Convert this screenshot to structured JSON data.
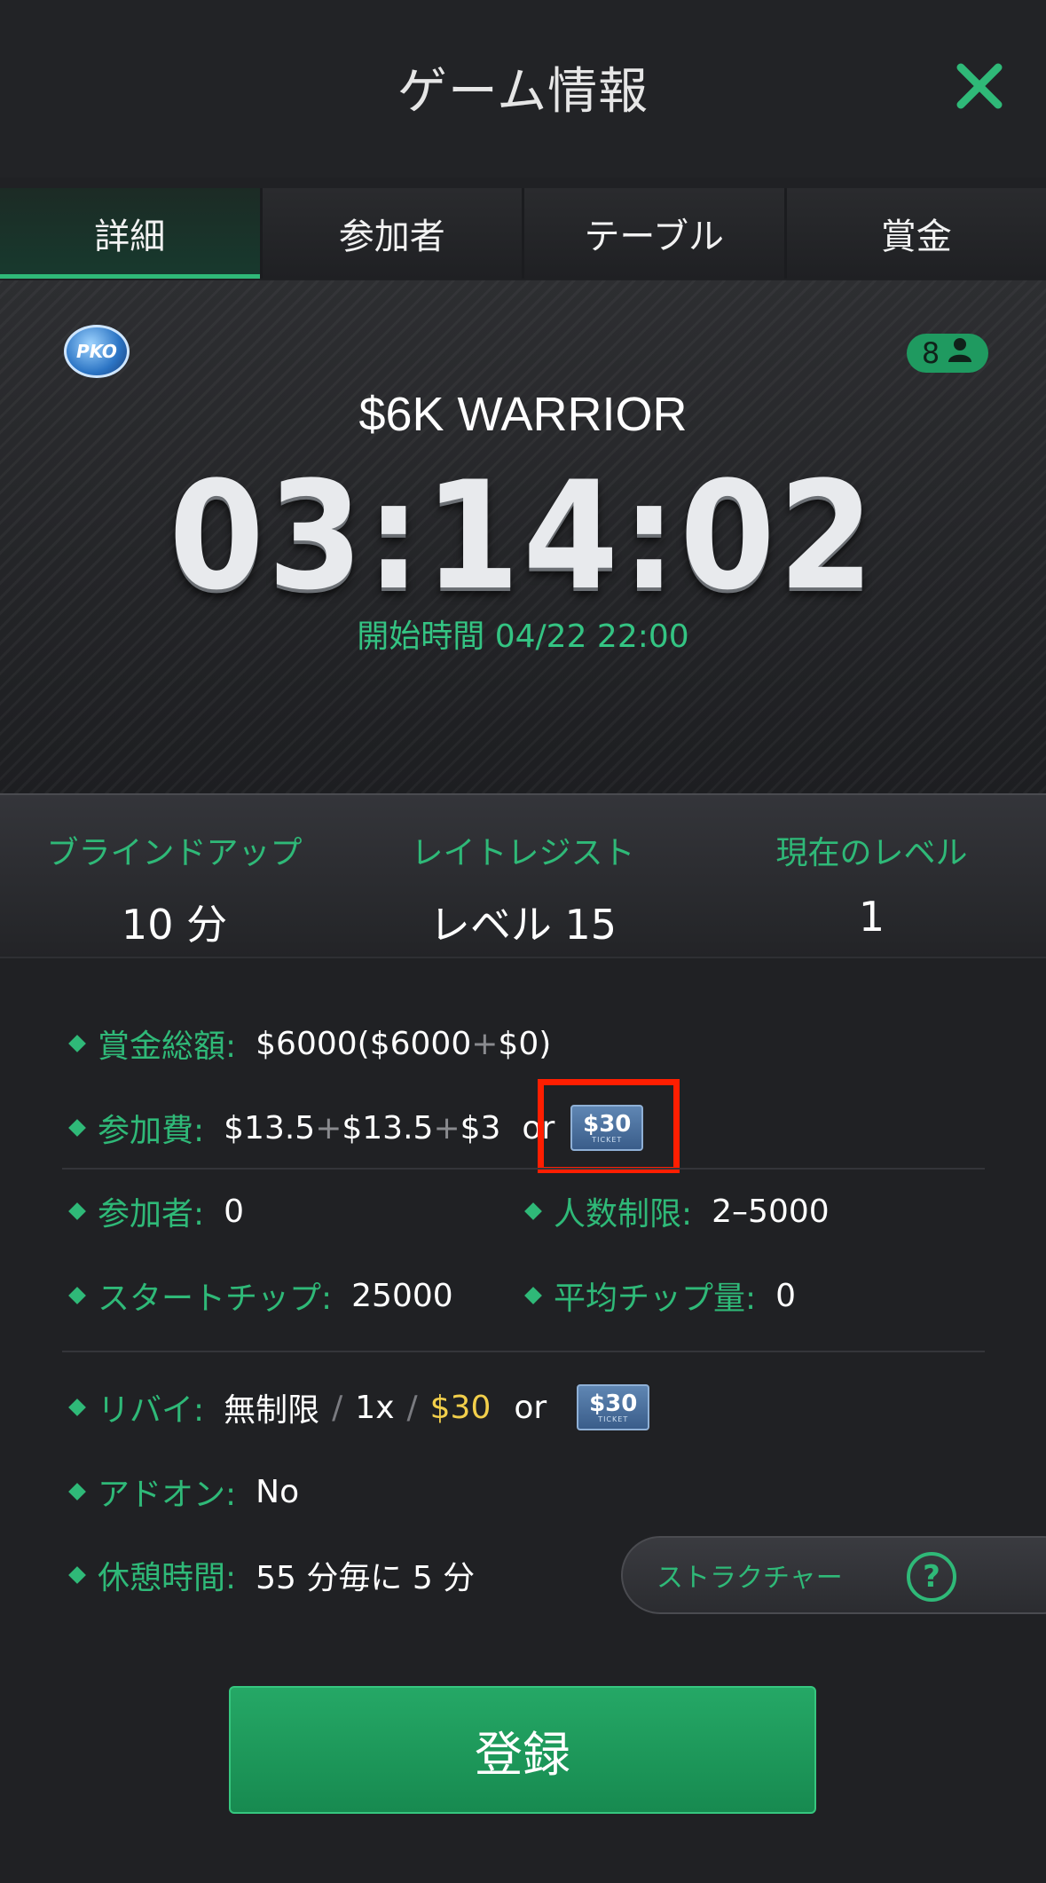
{
  "header": {
    "title": "ゲーム情報"
  },
  "tabs": [
    {
      "label": "詳細",
      "active": true
    },
    {
      "label": "参加者",
      "active": false
    },
    {
      "label": "テーブル",
      "active": false
    },
    {
      "label": "賞金",
      "active": false
    }
  ],
  "hero": {
    "badge": "PKO",
    "player_count": "8",
    "tournament_name": "$6K WARRIOR",
    "countdown": "03:14:02",
    "start_time": "開始時間 04/22 22:00"
  },
  "stats": [
    {
      "label": "ブラインドアップ",
      "value": "10 分"
    },
    {
      "label": "レイトレジスト",
      "value": "レベル 15"
    },
    {
      "label": "現在のレベル",
      "value": "1"
    }
  ],
  "info": {
    "prize_pool": {
      "label": "賞金総額:",
      "main": "$6000",
      "paren_open": " ($6000",
      "plus": "+",
      "paren_close": "$0)"
    },
    "entry_fee": {
      "label": "参加費:",
      "a": "$13.5",
      "plus1": "+",
      "b": "$13.5",
      "plus2": "+",
      "c": "$3",
      "or": "or"
    },
    "entrants": {
      "label": "参加者:",
      "value": "0"
    },
    "player_limit": {
      "label": "人数制限:",
      "value": "2–5000"
    },
    "start_chips": {
      "label": "スタートチップ:",
      "value": "25000"
    },
    "avg_chips": {
      "label": "平均チップ量:",
      "value": "0"
    },
    "rebuy": {
      "label": "リバイ:",
      "unlimited": "無制限",
      "slash": "/",
      "times": "1x",
      "cost": "$30",
      "or": "or"
    },
    "addon": {
      "label": "アドオン:",
      "value": "No"
    },
    "break": {
      "label": "休憩時間:",
      "value": "55 分毎に 5 分"
    }
  },
  "ticket": {
    "amount": "$30",
    "caption": "TICKET"
  },
  "structure_button": {
    "label": "ストラクチャー",
    "help": "?"
  },
  "register_button": {
    "label": "登録"
  },
  "colors": {
    "accent": "#2fb978",
    "highlight": "#ff1e00",
    "gold": "#f2cf4b"
  }
}
